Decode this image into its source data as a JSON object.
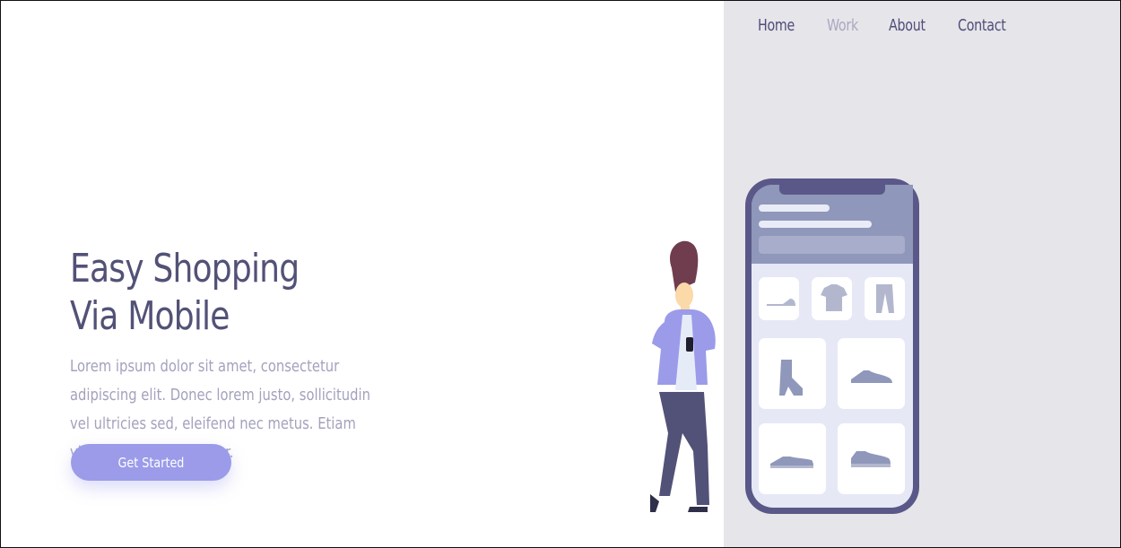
{
  "nav": {
    "items": [
      {
        "label": "Home",
        "active": false
      },
      {
        "label": "Work",
        "active": true
      },
      {
        "label": "About",
        "active": false
      },
      {
        "label": "Contact",
        "active": false
      }
    ]
  },
  "hero": {
    "title_line1": "Easy Shopping",
    "title_line2": "Via Mobile",
    "description": "Lorem ipsum dolor sit amet, consectetur adipiscing elit. Donec lorem justo, sollicitudin vel ultricies sed, eleifend nec metus. Etiam vitae pellentesque dolor.",
    "cta_label": "Get Started"
  },
  "colors": {
    "accent": "#9b9bea",
    "heading": "#525177",
    "muted_text": "#a3a2bd",
    "panel_bg": "#e6e5ea",
    "phone_frame": "#5a5888"
  },
  "illustration": {
    "phone_product_icons": [
      "shoe-icon",
      "tshirt-icon",
      "pants-icon",
      "boot-icon",
      "sneaker-icon",
      "sneaker-icon",
      "sneaker-icon"
    ]
  }
}
